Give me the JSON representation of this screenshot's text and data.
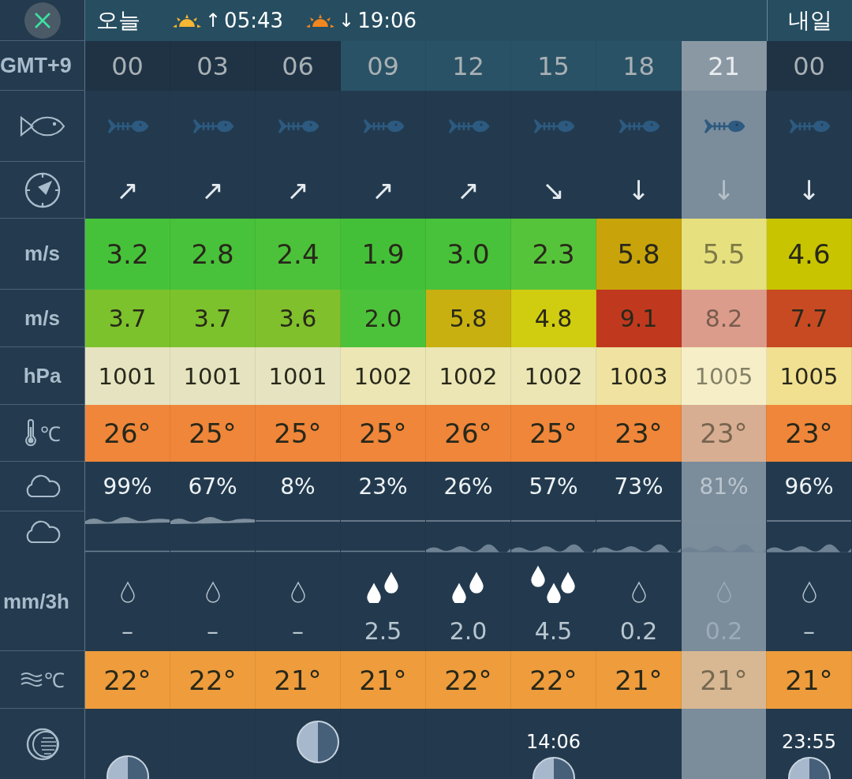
{
  "header": {
    "today_label": "오늘",
    "sunrise": {
      "arrow": "↑",
      "time": "05:43"
    },
    "sunset": {
      "arrow": "↓",
      "time": "19:06"
    },
    "tomorrow_label": "내일"
  },
  "row_labels": {
    "timezone": "GMT+9",
    "wind_unit": "m/s",
    "gust_unit": "m/s",
    "pressure_unit": "hPa",
    "temp_unit": "℃",
    "rain_unit": "mm/3h",
    "sea_temp_unit": "℃"
  },
  "columns": [
    {
      "hour": "00",
      "dim": true,
      "selected": false,
      "direction": "↗",
      "wind": {
        "value": "3.2",
        "color": "#46c23a"
      },
      "gust": {
        "value": "3.7",
        "color": "#7cc22c"
      },
      "pressure": {
        "value": "1001",
        "color": "#e6e4c0"
      },
      "temp": "26°",
      "cloud": "99%",
      "rain": {
        "kind": "dry",
        "amount": "–"
      },
      "sea_temp": "22°",
      "moon": {
        "kind": "low"
      }
    },
    {
      "hour": "03",
      "dim": true,
      "selected": false,
      "direction": "↗",
      "wind": {
        "value": "2.8",
        "color": "#48c23a"
      },
      "gust": {
        "value": "3.7",
        "color": "#7cc22c"
      },
      "pressure": {
        "value": "1001",
        "color": "#e6e4c0"
      },
      "temp": "25°",
      "cloud": "67%",
      "rain": {
        "kind": "dry",
        "amount": "–"
      },
      "sea_temp": "22°"
    },
    {
      "hour": "06",
      "dim": true,
      "selected": false,
      "direction": "↗",
      "wind": {
        "value": "2.4",
        "color": "#4cc23a"
      },
      "gust": {
        "value": "3.6",
        "color": "#80c02c"
      },
      "pressure": {
        "value": "1001",
        "color": "#e6e4c0"
      },
      "temp": "25°",
      "cloud": "8%",
      "rain": {
        "kind": "dry",
        "amount": "–"
      },
      "sea_temp": "21°",
      "moon": {
        "kind": "half"
      }
    },
    {
      "hour": "09",
      "dim": false,
      "selected": false,
      "direction": "↗",
      "wind": {
        "value": "1.9",
        "color": "#44c038"
      },
      "gust": {
        "value": "2.0",
        "color": "#4cc23a"
      },
      "pressure": {
        "value": "1002",
        "color": "#ebe6b4"
      },
      "temp": "25°",
      "cloud": "23%",
      "rain": {
        "kind": "light",
        "amount": "2.5"
      },
      "sea_temp": "21°"
    },
    {
      "hour": "12",
      "dim": false,
      "selected": false,
      "direction": "↗",
      "wind": {
        "value": "3.0",
        "color": "#48c23a"
      },
      "gust": {
        "value": "5.8",
        "color": "#c8b010"
      },
      "pressure": {
        "value": "1002",
        "color": "#ebe6b4"
      },
      "temp": "26°",
      "cloud": "26%",
      "rain": {
        "kind": "light",
        "amount": "2.0"
      },
      "sea_temp": "22°"
    },
    {
      "hour": "15",
      "dim": false,
      "selected": false,
      "direction": "↘",
      "wind": {
        "value": "2.3",
        "color": "#56c43a"
      },
      "gust": {
        "value": "4.8",
        "color": "#d0cc10"
      },
      "pressure": {
        "value": "1002",
        "color": "#ebe6b4"
      },
      "temp": "25°",
      "cloud": "57%",
      "rain": {
        "kind": "heavy",
        "amount": "4.5"
      },
      "sea_temp": "22°",
      "moon": {
        "kind": "low",
        "time": "14:06"
      }
    },
    {
      "hour": "18",
      "dim": false,
      "selected": false,
      "direction": "↓",
      "wind": {
        "value": "5.8",
        "color": "#c8a40a"
      },
      "gust": {
        "value": "9.1",
        "color": "#c0381e"
      },
      "pressure": {
        "value": "1003",
        "color": "#f0e2a0"
      },
      "temp": "23°",
      "cloud": "73%",
      "rain": {
        "kind": "dry",
        "amount": "0.2"
      },
      "sea_temp": "21°"
    },
    {
      "hour": "21",
      "dim": false,
      "selected": true,
      "direction": "↓",
      "wind": {
        "value": "5.5",
        "color": "#e6e07e"
      },
      "gust": {
        "value": "8.2",
        "color": "#dc9c8c"
      },
      "pressure": {
        "value": "1005",
        "color": "#f6eec6"
      },
      "temp": "23°",
      "cloud": "81%",
      "rain": {
        "kind": "dry",
        "amount": "0.2"
      },
      "sea_temp": "21°"
    },
    {
      "hour": "00",
      "dim": true,
      "selected": false,
      "direction": "↓",
      "wind": {
        "value": "4.6",
        "color": "#c8c400"
      },
      "gust": {
        "value": "7.7",
        "color": "#c84a22"
      },
      "pressure": {
        "value": "1005",
        "color": "#f0e090"
      },
      "temp": "23°",
      "cloud": "96%",
      "rain": {
        "kind": "dry",
        "amount": "–"
      },
      "sea_temp": "21°",
      "moon": {
        "kind": "low",
        "time": "23:55"
      }
    }
  ]
}
